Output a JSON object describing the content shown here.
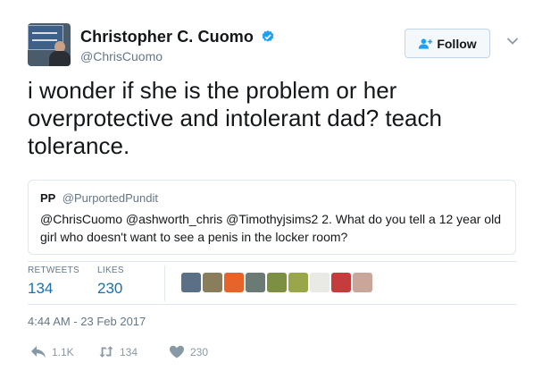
{
  "author": {
    "display_name": "Christopher C. Cuomo",
    "handle": "@ChrisCuomo",
    "verified": true
  },
  "follow_button": {
    "label": "Follow"
  },
  "tweet": {
    "text": "i wonder if she is the problem or her overprotective and intolerant dad? teach tolerance."
  },
  "quoted_tweet": {
    "name": "PP",
    "handle": "@PurportedPundit",
    "text": "@ChrisCuomo @ashworth_chris @Timothyjsims2 2. What do you tell a 12 year old girl who doesn't want to see a penis in the locker room?"
  },
  "stats": {
    "retweets_label": "RETWEETS",
    "retweets_value": "134",
    "likes_label": "LIKES",
    "likes_value": "230"
  },
  "liker_avatars": [
    {
      "name": "liker-1",
      "color": "#5b6f86"
    },
    {
      "name": "liker-2",
      "color": "#8a7d5c"
    },
    {
      "name": "liker-3",
      "color": "#e8632a"
    },
    {
      "name": "liker-4",
      "color": "#6b7a74"
    },
    {
      "name": "liker-5",
      "color": "#7c8f42"
    },
    {
      "name": "liker-6",
      "color": "#9aa64a"
    },
    {
      "name": "liker-7",
      "color": "#e9e9e6"
    },
    {
      "name": "liker-8",
      "color": "#c43c3c"
    },
    {
      "name": "liker-9",
      "color": "#c9a59a"
    }
  ],
  "timestamp": "4:44 AM - 23 Feb 2017",
  "actions": {
    "reply_count": "1.1K",
    "retweet_count": "134",
    "like_count": "230"
  },
  "colors": {
    "accent": "#1b6fae",
    "verified": "#1da1f2",
    "secondary_text": "#657786"
  }
}
